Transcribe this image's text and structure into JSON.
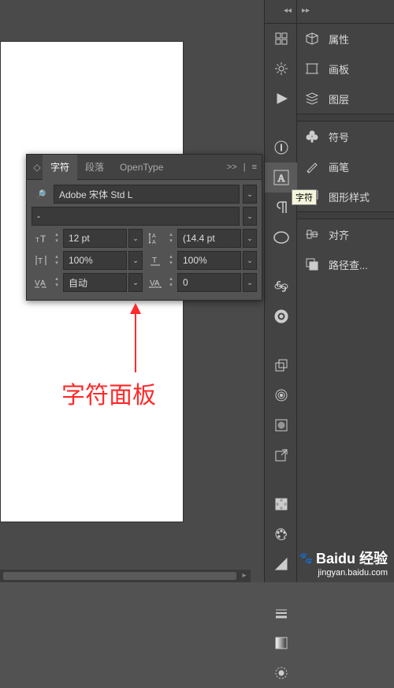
{
  "panels": {
    "properties": "属性",
    "artboards": "画板",
    "layers": "图层",
    "symbols": "符号",
    "brushes": "画笔",
    "graphic_styles": "图形样式",
    "align": "对齐",
    "pathfinder": "路径查..."
  },
  "char_panel": {
    "tabs": {
      "character": "字符",
      "paragraph": "段落",
      "opentype": "OpenType"
    },
    "expand": ">>",
    "font_family": "Adobe 宋体 Std L",
    "font_style": "-",
    "font_size": "12 pt",
    "leading": "(14.4 pt",
    "h_scale": "100%",
    "v_scale": "100%",
    "kerning": "自动",
    "tracking": "0"
  },
  "tooltip": "字符",
  "annotation": "字符面板",
  "watermark": {
    "brand": "Baidu 经验",
    "url": "jingyan.baidu.com"
  }
}
